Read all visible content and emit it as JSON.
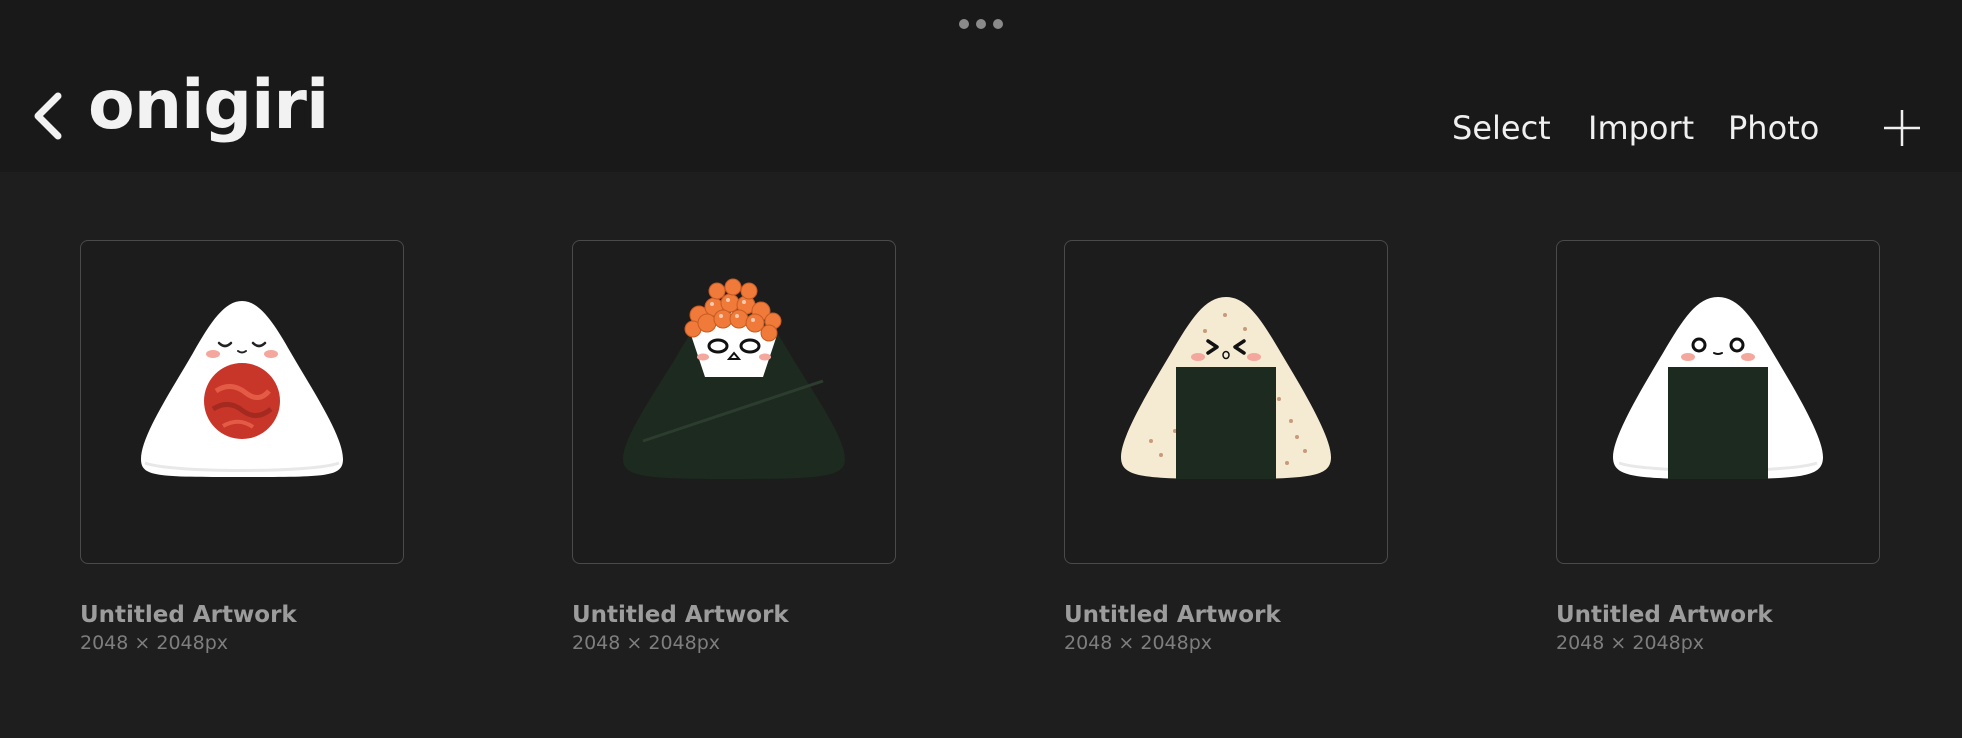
{
  "header": {
    "title": "onigiri",
    "actions": {
      "select": "Select",
      "import": "Import",
      "photo": "Photo"
    },
    "icons": {
      "back": "chevron-left-icon",
      "more": "more-dots-icon",
      "add": "plus-icon"
    }
  },
  "artworks": [
    {
      "title": "Untitled Artwork",
      "size": "2048 × 2048px",
      "art": "umeboshi-onigiri"
    },
    {
      "title": "Untitled Artwork",
      "size": "2048 × 2048px",
      "art": "ikura-onigiri"
    },
    {
      "title": "Untitled Artwork",
      "size": "2048 × 2048px",
      "art": "brown-rice-onigiri"
    },
    {
      "title": "Untitled Artwork",
      "size": "2048 × 2048px",
      "art": "plain-nori-onigiri"
    }
  ],
  "colors": {
    "background": "#1e1e1e",
    "header": "#191919",
    "rice": "#ffffff",
    "nori": "#1d2a1f",
    "umeboshi": "#d2402c",
    "ikura": "#ef7a3a",
    "brown_rice": "#f5ead2",
    "blush": "#f4a79d"
  }
}
